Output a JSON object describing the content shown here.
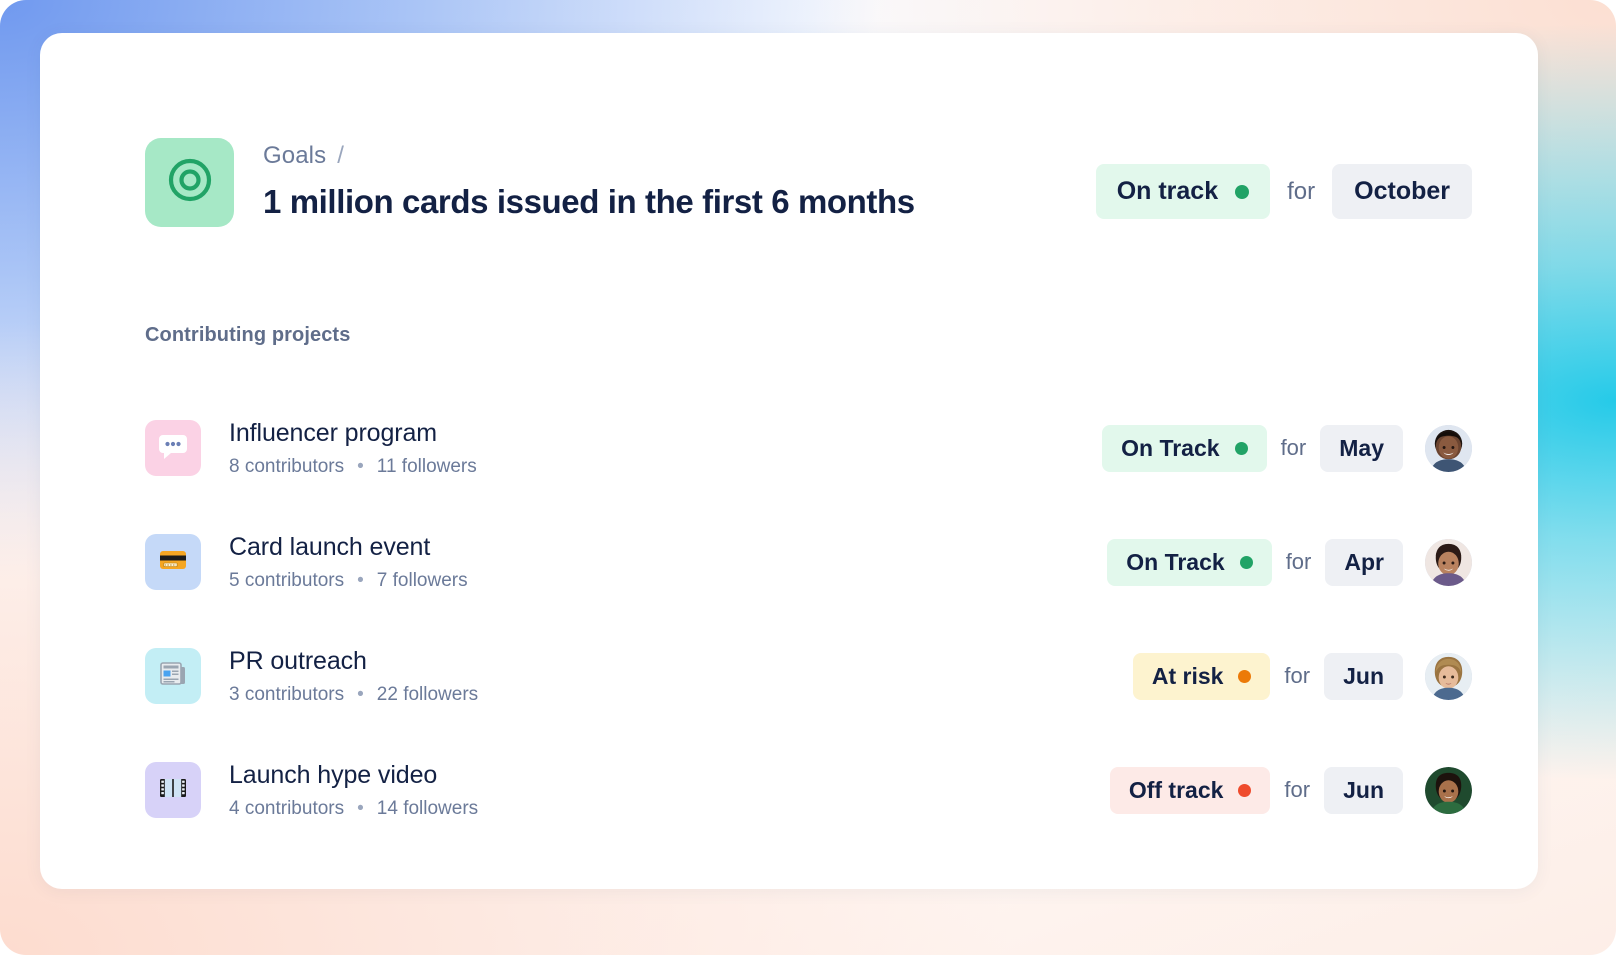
{
  "background": {
    "gradient_colors": {
      "top_left_blue": "#7099ef",
      "top_right_peach": "#fcdfd2",
      "right_cyan": "#1ac8e8",
      "bottom_left_peach": "#fddccf",
      "center_white": "#ffffff"
    }
  },
  "card": {
    "background": "#ffffff"
  },
  "goal": {
    "icon_name": "goal-target-icon",
    "icon_tile_color": "#a6e8c6",
    "icon_glyph_color": "#21a366",
    "breadcrumb": {
      "parent": "Goals",
      "separator": "/"
    },
    "title": "1 million cards issued in the first 6 months",
    "status": {
      "label": "On track",
      "tone": "on-track",
      "dot_color": "#21a366",
      "pill_color": "#e2f8ec"
    },
    "for_label": "for",
    "period": "October"
  },
  "projects_section": {
    "label": "Contributing projects",
    "for_label": "for",
    "items": [
      {
        "name": "Influencer program",
        "contributors": "8 contributors",
        "separator": "•",
        "followers": "11 followers",
        "icon_name": "speech-bubble-icon",
        "icon_tile_color": "#fbd2e5",
        "status": {
          "label": "On Track",
          "tone": "on-track",
          "dot_color": "#21a366",
          "pill_color": "#e2f8ec"
        },
        "period": "May",
        "avatar_name": "avatar-influencer-program-owner"
      },
      {
        "name": "Card launch event",
        "contributors": "5 contributors",
        "separator": "•",
        "followers": "7 followers",
        "icon_name": "credit-card-icon",
        "icon_tile_color": "#c5d9f8",
        "status": {
          "label": "On Track",
          "tone": "on-track",
          "dot_color": "#21a366",
          "pill_color": "#e2f8ec"
        },
        "period": "Apr",
        "avatar_name": "avatar-card-launch-event-owner"
      },
      {
        "name": "PR outreach",
        "contributors": "3 contributors",
        "separator": "•",
        "followers": "22 followers",
        "icon_name": "newspaper-icon",
        "icon_tile_color": "#c3eef5",
        "status": {
          "label": "At risk",
          "tone": "at-risk",
          "dot_color": "#ec7a08",
          "pill_color": "#fdf3cf"
        },
        "period": "Jun",
        "avatar_name": "avatar-pr-outreach-owner"
      },
      {
        "name": "Launch hype video",
        "contributors": "4 contributors",
        "separator": "•",
        "followers": "14 followers",
        "icon_name": "film-strip-icon",
        "icon_tile_color": "#d7d2f8",
        "status": {
          "label": "Off track",
          "tone": "off-track",
          "dot_color": "#ef4b2c",
          "pill_color": "#fdeae7"
        },
        "period": "Jun",
        "avatar_name": "avatar-launch-hype-video-owner"
      }
    ]
  }
}
